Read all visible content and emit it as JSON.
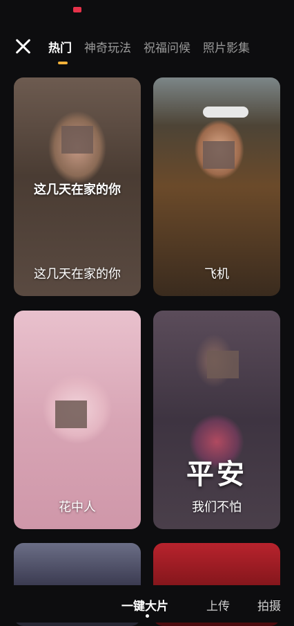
{
  "tabs": [
    "热门",
    "神奇玩法",
    "祝福问候",
    "照片影集"
  ],
  "cards": [
    {
      "label": "这几天在家的你",
      "overlay": "这几天在家的你"
    },
    {
      "label": "飞机"
    },
    {
      "label": "花中人"
    },
    {
      "label": "我们不怕",
      "overlay": "平安"
    }
  ],
  "bottom_nav": [
    "一键大片",
    "上传",
    "拍摄"
  ],
  "colors": {
    "background": "#0d0d0f",
    "accent": "#f3b23a"
  }
}
